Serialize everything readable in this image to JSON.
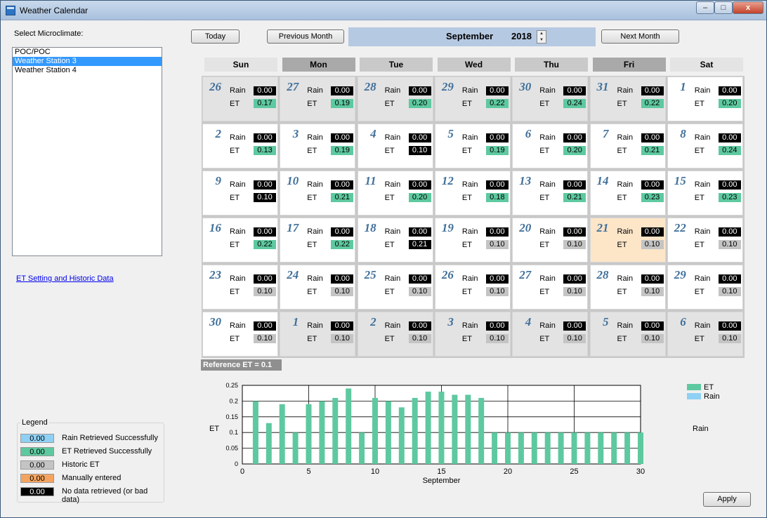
{
  "window": {
    "title": "Weather Calendar",
    "min_icon": "minimize-icon",
    "max_icon": "maximize-icon",
    "close_icon": "close-icon",
    "close_glyph": "x"
  },
  "microclimate": {
    "label": "Select Microclimate:",
    "items": [
      "POC/POC",
      "Weather Station 3",
      "Weather Station 4"
    ],
    "selected": "Weather Station 3"
  },
  "et_link": "ET Setting and Historic Data",
  "nav": {
    "today": "Today",
    "prev": "Previous Month",
    "month": "September",
    "year": "2018",
    "next": "Next Month"
  },
  "weekdays": [
    "Sun",
    "Mon",
    "Tue",
    "Wed",
    "Thu",
    "Fri",
    "Sat"
  ],
  "labels": {
    "rain": "Rain",
    "et": "ET"
  },
  "calendar": [
    [
      {
        "d": "26",
        "r": "0.00",
        "e": "0.17",
        "ec": "green",
        "other": true
      },
      {
        "d": "27",
        "r": "0.00",
        "e": "0.19",
        "ec": "green",
        "other": true
      },
      {
        "d": "28",
        "r": "0.00",
        "e": "0.20",
        "ec": "green",
        "other": true
      },
      {
        "d": "29",
        "r": "0.00",
        "e": "0.22",
        "ec": "green",
        "other": true
      },
      {
        "d": "30",
        "r": "0.00",
        "e": "0.24",
        "ec": "green",
        "other": true
      },
      {
        "d": "31",
        "r": "0.00",
        "e": "0.22",
        "ec": "green",
        "other": true
      },
      {
        "d": "1",
        "r": "0.00",
        "e": "0.20",
        "ec": "green"
      }
    ],
    [
      {
        "d": "2",
        "r": "0.00",
        "e": "0.13",
        "ec": "green"
      },
      {
        "d": "3",
        "r": "0.00",
        "e": "0.19",
        "ec": "green"
      },
      {
        "d": "4",
        "r": "0.00",
        "e": "0.10",
        "ec": "black"
      },
      {
        "d": "5",
        "r": "0.00",
        "e": "0.19",
        "ec": "green"
      },
      {
        "d": "6",
        "r": "0.00",
        "e": "0.20",
        "ec": "green"
      },
      {
        "d": "7",
        "r": "0.00",
        "e": "0.21",
        "ec": "green"
      },
      {
        "d": "8",
        "r": "0.00",
        "e": "0.24",
        "ec": "green"
      }
    ],
    [
      {
        "d": "9",
        "r": "0.00",
        "e": "0.10",
        "ec": "black"
      },
      {
        "d": "10",
        "r": "0.00",
        "e": "0.21",
        "ec": "green"
      },
      {
        "d": "11",
        "r": "0.00",
        "e": "0.20",
        "ec": "green"
      },
      {
        "d": "12",
        "r": "0.00",
        "e": "0.18",
        "ec": "green"
      },
      {
        "d": "13",
        "r": "0.00",
        "e": "0.21",
        "ec": "green"
      },
      {
        "d": "14",
        "r": "0.00",
        "e": "0.23",
        "ec": "green"
      },
      {
        "d": "15",
        "r": "0.00",
        "e": "0.23",
        "ec": "green"
      }
    ],
    [
      {
        "d": "16",
        "r": "0.00",
        "e": "0.22",
        "ec": "green"
      },
      {
        "d": "17",
        "r": "0.00",
        "e": "0.22",
        "ec": "green"
      },
      {
        "d": "18",
        "r": "0.00",
        "e": "0.21",
        "ec": "black"
      },
      {
        "d": "19",
        "r": "0.00",
        "e": "0.10",
        "ec": "gray"
      },
      {
        "d": "20",
        "r": "0.00",
        "e": "0.10",
        "ec": "gray"
      },
      {
        "d": "21",
        "r": "0.00",
        "e": "0.10",
        "ec": "gray",
        "today": true
      },
      {
        "d": "22",
        "r": "0.00",
        "e": "0.10",
        "ec": "gray"
      }
    ],
    [
      {
        "d": "23",
        "r": "0.00",
        "e": "0.10",
        "ec": "gray"
      },
      {
        "d": "24",
        "r": "0.00",
        "e": "0.10",
        "ec": "gray"
      },
      {
        "d": "25",
        "r": "0.00",
        "e": "0.10",
        "ec": "gray"
      },
      {
        "d": "26",
        "r": "0.00",
        "e": "0.10",
        "ec": "gray"
      },
      {
        "d": "27",
        "r": "0.00",
        "e": "0.10",
        "ec": "gray"
      },
      {
        "d": "28",
        "r": "0.00",
        "e": "0.10",
        "ec": "gray"
      },
      {
        "d": "29",
        "r": "0.00",
        "e": "0.10",
        "ec": "gray"
      }
    ],
    [
      {
        "d": "30",
        "r": "0.00",
        "e": "0.10",
        "ec": "gray"
      },
      {
        "d": "1",
        "r": "0.00",
        "e": "0.10",
        "ec": "gray",
        "other": true
      },
      {
        "d": "2",
        "r": "0.00",
        "e": "0.10",
        "ec": "gray",
        "other": true
      },
      {
        "d": "3",
        "r": "0.00",
        "e": "0.10",
        "ec": "gray",
        "other": true
      },
      {
        "d": "4",
        "r": "0.00",
        "e": "0.10",
        "ec": "gray",
        "other": true
      },
      {
        "d": "5",
        "r": "0.00",
        "e": "0.10",
        "ec": "gray",
        "other": true
      },
      {
        "d": "6",
        "r": "0.00",
        "e": "0.10",
        "ec": "gray",
        "other": true
      }
    ]
  ],
  "reference_et": "Reference ET = 0.1",
  "chart_data": {
    "type": "bar",
    "x": [
      1,
      2,
      3,
      4,
      5,
      6,
      7,
      8,
      9,
      10,
      11,
      12,
      13,
      14,
      15,
      16,
      17,
      18,
      19,
      20,
      21,
      22,
      23,
      24,
      25,
      26,
      27,
      28,
      29,
      30
    ],
    "series": [
      {
        "name": "ET",
        "values": [
          0.2,
          0.13,
          0.19,
          0.1,
          0.19,
          0.2,
          0.21,
          0.24,
          0.1,
          0.21,
          0.2,
          0.18,
          0.21,
          0.23,
          0.23,
          0.22,
          0.22,
          0.21,
          0.1,
          0.1,
          0.1,
          0.1,
          0.1,
          0.1,
          0.1,
          0.1,
          0.1,
          0.1,
          0.1,
          0.1
        ]
      },
      {
        "name": "Rain",
        "values": [
          0,
          0,
          0,
          0,
          0,
          0,
          0,
          0,
          0,
          0,
          0,
          0,
          0,
          0,
          0,
          0,
          0,
          0,
          0,
          0,
          0,
          0,
          0,
          0,
          0,
          0,
          0,
          0,
          0,
          0
        ]
      }
    ],
    "xlabel": "September",
    "ylabel": "ET",
    "y2label": "Rain",
    "xlim": [
      0,
      30
    ],
    "ylim": [
      0,
      0.25
    ],
    "xticks": [
      "0",
      "5",
      "10",
      "15",
      "20",
      "25",
      "30"
    ],
    "yticks": [
      "0",
      "0.05",
      "0.1",
      "0.15",
      "0.2",
      "0.25"
    ],
    "grid": true,
    "legend": "top-right",
    "colors": {
      "ET": "#5ec9a0",
      "Rain": "#8fd0f5"
    }
  },
  "legend": {
    "title": "Legend",
    "items": [
      {
        "value": "0.00",
        "label": "Rain Retrieved Successfully",
        "color": "#8fd0f5"
      },
      {
        "value": "0.00",
        "label": "ET Retrieved Successfully",
        "color": "#5ec9a0"
      },
      {
        "value": "0.00",
        "label": "Historic ET",
        "color": "#c4c4c4"
      },
      {
        "value": "0.00",
        "label": "Manually entered",
        "color": "#f4a460"
      },
      {
        "value": "0.00",
        "label": "No data retrieved (or bad data)",
        "color": "#000000"
      }
    ]
  },
  "apply": "Apply"
}
